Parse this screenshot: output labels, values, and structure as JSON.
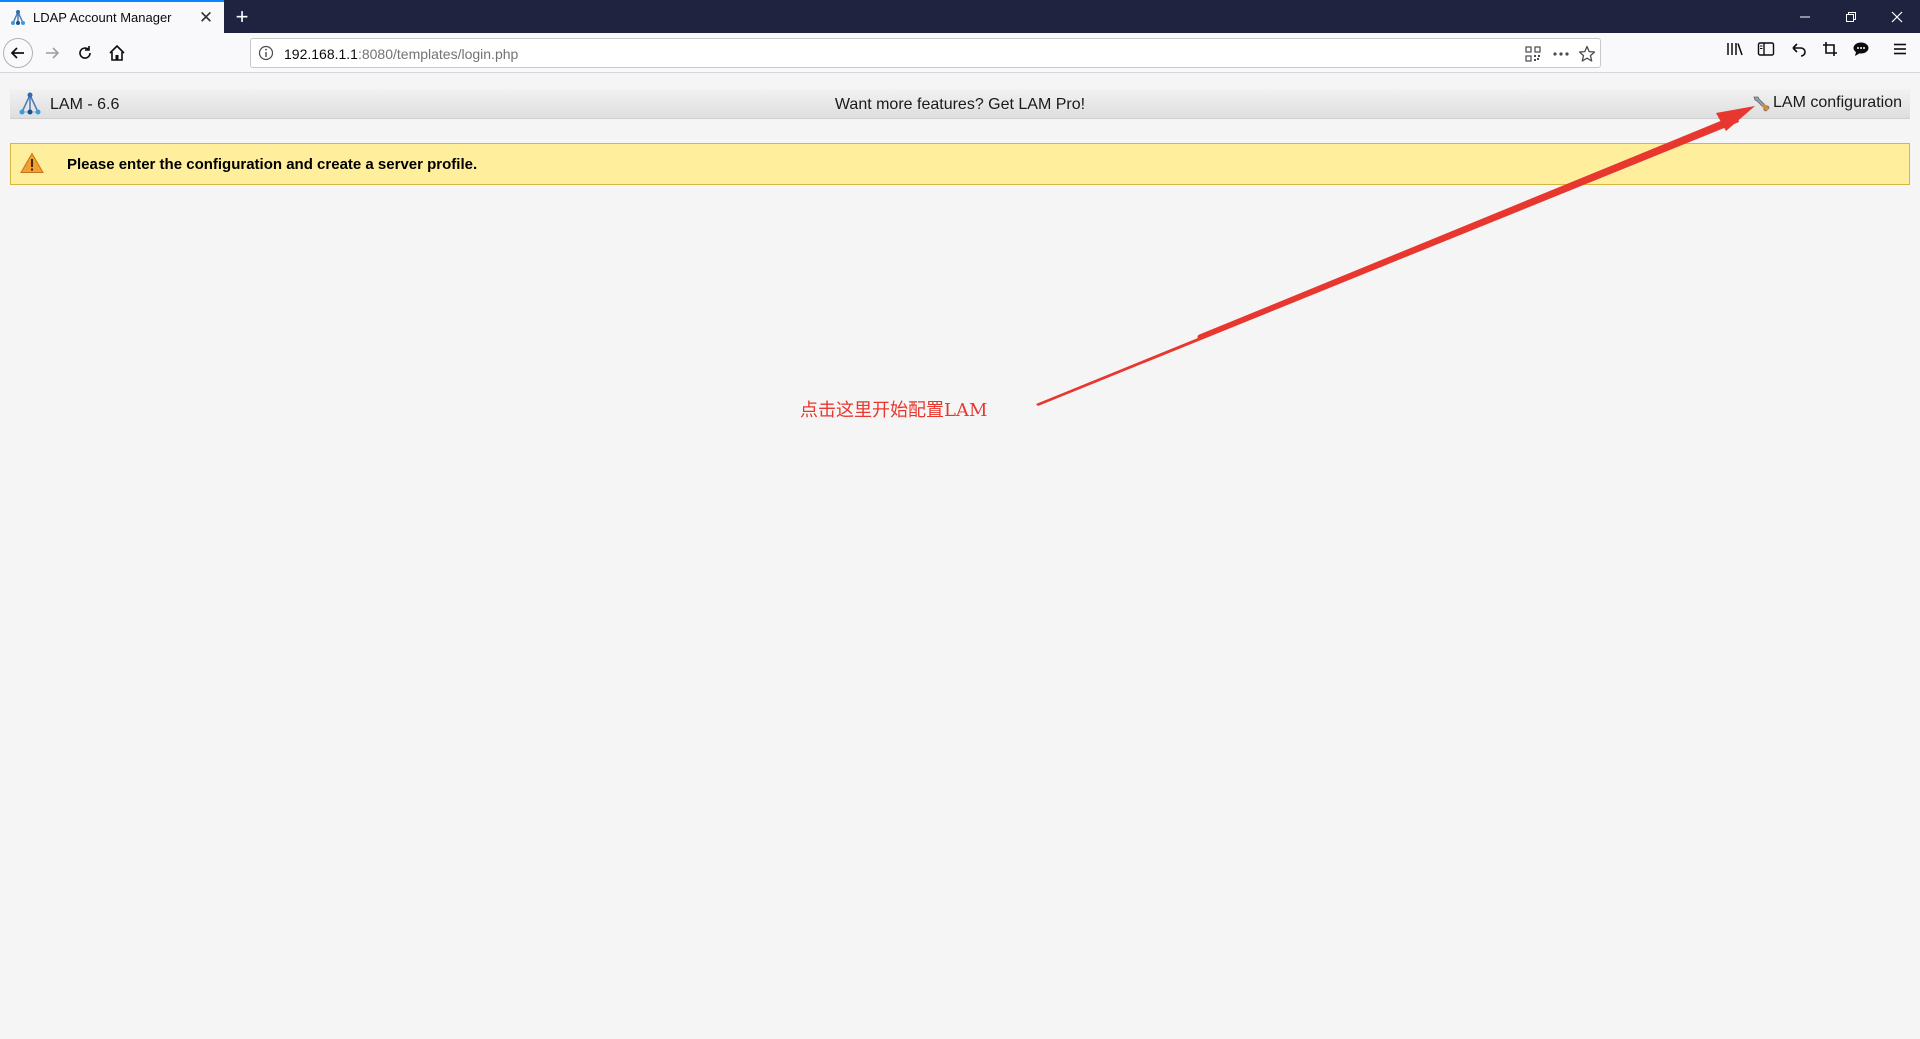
{
  "browser": {
    "tab": {
      "title": "LDAP Account Manager"
    },
    "url": {
      "host": "192.168.1.1",
      "rest": ":8080/templates/login.php"
    }
  },
  "lam": {
    "version": "LAM - 6.6",
    "promo": "Want more features? Get LAM Pro!",
    "config_link": "LAM configuration",
    "warning": "Please enter the configuration and create a server profile."
  },
  "annotation": {
    "text": "点击这里开始配置LAM",
    "color": "#e8372e"
  },
  "colors": {
    "accent_tab": "#0a84ff",
    "warning_bg": "#ffef9d",
    "titlebar": "#202340"
  }
}
